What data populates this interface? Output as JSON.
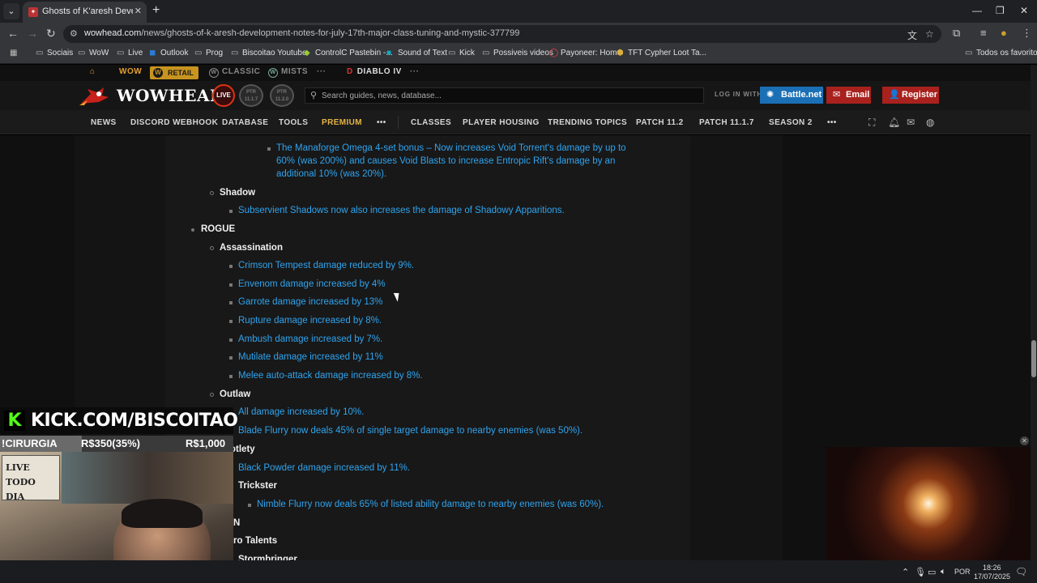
{
  "browser": {
    "tab_title": "Ghosts of K'aresh Developmen",
    "url_domain": "wowhead.com",
    "url_path": "/news/ghosts-of-k-aresh-development-notes-for-july-17th-major-class-tuning-and-mystic-377799",
    "bookmarks": [
      "Sociais",
      "WoW",
      "Live",
      "Outlook",
      "Prog",
      "Biscoitao Youtube",
      "ControlC Pastebin -...",
      "Sound of Text",
      "Kick",
      "Possiveis videos",
      "Payoneer: Home",
      "TFT Cypher Loot Ta..."
    ],
    "all_bookmarks": "Todos os favoritos"
  },
  "site": {
    "top": {
      "wow": "WOW",
      "retail": "RETAIL",
      "classic": "CLASSIC",
      "mists": "MISTS",
      "more1": "···",
      "diablo": "DIABLO IV",
      "more2": "···"
    },
    "logo": "WOWHEAD",
    "live": "LIVE",
    "ptr1": [
      "PTR",
      "11.1.7"
    ],
    "ptr2": [
      "PTR",
      "11.2.0"
    ],
    "search_placeholder": "Search guides, news, database...",
    "login_label": "LOG IN WITH:",
    "battlenet": "Battle.net",
    "email": "Email",
    "register": "Register",
    "nav": [
      "NEWS",
      "DISCORD WEBHOOK",
      "DATABASE",
      "TOOLS",
      "PREMIUM",
      "•••",
      "CLASSES",
      "PLAYER HOUSING",
      "TRENDING TOPICS",
      "PATCH 11.2",
      "PATCH 11.1.7",
      "SEASON 2",
      "•••"
    ]
  },
  "content": {
    "manaforge_line1": "The Manaforge Omega 4-set bonus – Now increases Void Torrent's damage by up to",
    "manaforge_line2": "60% (was 200%) and causes Void Blasts to increase Entropic Rift's damage by an",
    "manaforge_line3": "additional 10% (was 20%).",
    "shadow": "Shadow",
    "shadow_1": "Subservient Shadows now also increases the damage of Shadowy Apparitions.",
    "rogue": "ROGUE",
    "assassination": "Assassination",
    "assassination_items": [
      "Crimson Tempest damage reduced by 9%.",
      "Envenom damage increased by 4%",
      "Garrote damage increased by 13%",
      "Rupture damage increased by 8%.",
      "Ambush damage increased by 7%.",
      "Mutilate damage increased by 11%",
      "Melee auto-attack damage increased by 8%."
    ],
    "outlaw": "Outlaw",
    "outlaw_items": [
      "All damage increased by 10%.",
      "Blade Flurry now deals 45% of single target damage to nearby enemies (was 50%)."
    ],
    "subtlety": "otlety",
    "subtlety_1": "Black Powder damage increased by 11%.",
    "trickster": "Trickster",
    "trickster_1": "Nimble Flurry now deals 65% of listed ability damage to nearby enemies (was 60%).",
    "shaman_partial": "N",
    "hero_talents": "ro Talents",
    "stormbringer": "Stormbringer"
  },
  "stream": {
    "kick_url": "KICK.COM/BISCOITAO",
    "goal_label": "!CIRURGIA",
    "goal_current": "R$350(35%)",
    "goal_target": "R$1,000",
    "goal_fraction": 0.35,
    "sign": [
      "LIVE",
      "TODO DIA"
    ]
  },
  "taskbar": {
    "lang": "POR",
    "time": "18:26",
    "date": "17/07/2025",
    "notifications": "6"
  }
}
